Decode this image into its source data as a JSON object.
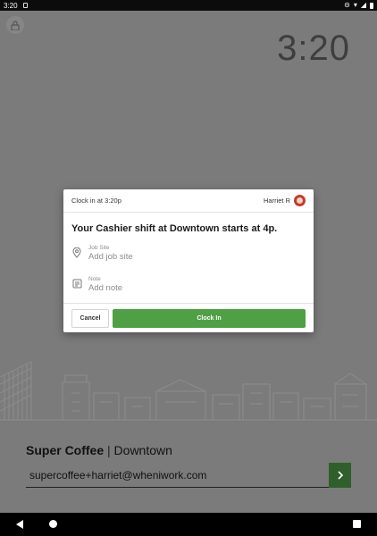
{
  "status_bar": {
    "time": "3:20",
    "icons": [
      "sd-card-icon",
      "do-not-disturb-icon",
      "wifi-icon",
      "signal-icon",
      "battery-icon"
    ]
  },
  "lock_screen": {
    "clock": "3:20",
    "lock_icon": "lock-icon"
  },
  "modal": {
    "header_text": "Clock in at 3:20p",
    "user_name": "Harriet R",
    "shift_message": "Your Cashier shift at Downtown starts at 4p.",
    "job_site": {
      "label": "Job Site",
      "value": "Add job site",
      "icon": "location-pin-icon"
    },
    "note": {
      "label": "Note",
      "value": "Add note",
      "icon": "note-icon"
    },
    "cancel_label": "Cancel",
    "clock_in_label": "Clock In"
  },
  "footer_login": {
    "company": "Super Coffee",
    "separator": "|",
    "location": "Downtown",
    "email_value": "supercoffee+harriet@wheniwork.com",
    "go_icon": "chevron-right-icon"
  },
  "colors": {
    "accent_green": "#4f9f44",
    "go_button": "#2f5f2a",
    "backdrop": "#7b7b7b"
  }
}
